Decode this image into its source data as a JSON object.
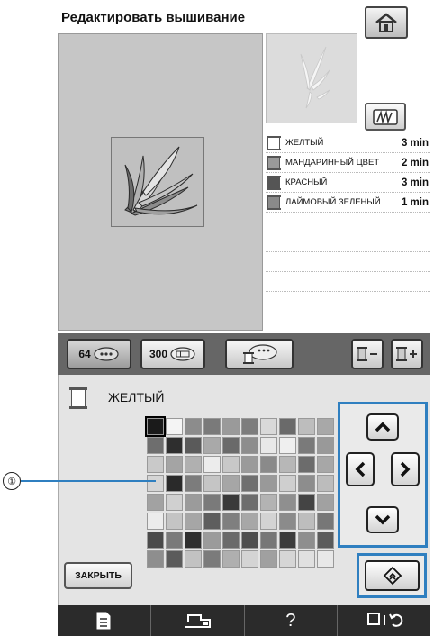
{
  "header": {
    "title": "Редактировать вышивание"
  },
  "toolbar": {
    "btn_64": "64",
    "btn_300": "300"
  },
  "threads": [
    {
      "name": "ЖЕЛТЫЙ",
      "time": "3 min",
      "color": "#ffffff"
    },
    {
      "name": "МАНДАРИННЫЙ ЦВЕТ",
      "time": "2 min",
      "color": "#9a9a9a"
    },
    {
      "name": "КРАСНЫЙ",
      "time": "3 min",
      "color": "#555555"
    },
    {
      "name": "ЛАЙМОВЫЙ ЗЕЛЕНЫЙ",
      "time": "1 min",
      "color": "#8a8a8a"
    }
  ],
  "selected_thread": {
    "name": "ЖЕЛТЫЙ"
  },
  "panel": {
    "close_label": "ЗАКРЫТЬ"
  },
  "bottom_bar": {
    "help_label": "?"
  },
  "callout": {
    "number": "①"
  },
  "palette": [
    [
      "#1a1a1a",
      "#f4f4f4",
      "#8c8c8c",
      "#7a7a7a",
      "#9a9a9a",
      "#7d7d7d",
      "#d9d9d9",
      "#6a6a6a",
      "#bdbdbd",
      "#a8a8a8"
    ],
    [
      "#6e6e6e",
      "#2e2e2e",
      "#5a5a5a",
      "#a9a9a9",
      "#6a6a6a",
      "#8d8d8d",
      "#e8e8e8",
      "#efefef",
      "#7a7a7a",
      "#999999"
    ],
    [
      "#c9c9c9",
      "#a4a4a4",
      "#b0b0b0",
      "#ececec",
      "#c8c8c8",
      "#9a9a9a",
      "#8a8a8a",
      "#b7b7b7",
      "#6c6c6c",
      "#a7a7a7"
    ],
    [
      "#d5d5d5",
      "#2a2a2a",
      "#7c7c7c",
      "#c5c5c5",
      "#a6a6a6",
      "#6f6f6f",
      "#999999",
      "#cfcfcf",
      "#8d8d8d",
      "#bcbcbc"
    ],
    [
      "#a2a2a2",
      "#d0d0d0",
      "#9b9b9b",
      "#7a7a7a",
      "#3a3a3a",
      "#6d6d6d",
      "#b3b3b3",
      "#8f8f8f",
      "#444444",
      "#a1a1a1"
    ],
    [
      "#ececec",
      "#c4c4c4",
      "#a6a6a6",
      "#5e5e5e",
      "#7f7f7f",
      "#a7a7a7",
      "#d3d3d3",
      "#8b8b8b",
      "#bdbdbd",
      "#777777"
    ],
    [
      "#4a4a4a",
      "#7a7a7a",
      "#2e2e2e",
      "#9b9b9b",
      "#6a6a6a",
      "#4e4e4e",
      "#777777",
      "#3c3c3c",
      "#8e8e8e",
      "#5b5b5b"
    ],
    [
      "#8e8e8e",
      "#5b5b5b",
      "#c2c2c2",
      "#7b7b7b",
      "#afafaf",
      "#d4d4d4",
      "#a0a0a0",
      "#d6d6d6",
      "#e0e0e0",
      "#e8e8e8"
    ]
  ]
}
